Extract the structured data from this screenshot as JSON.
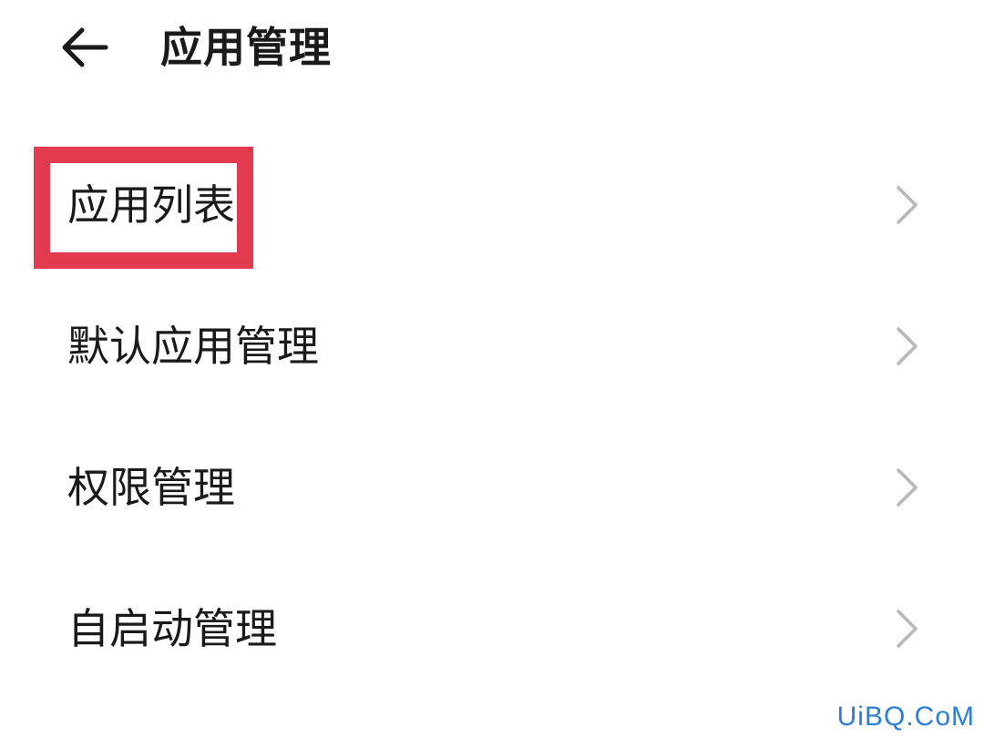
{
  "header": {
    "back_icon": "arrow-left-icon",
    "title": "应用管理"
  },
  "menu": {
    "items": [
      {
        "label": "应用列表",
        "icon": "chevron-right-icon",
        "highlighted": true
      },
      {
        "label": "默认应用管理",
        "icon": "chevron-right-icon",
        "highlighted": false
      },
      {
        "label": "权限管理",
        "icon": "chevron-right-icon",
        "highlighted": false
      },
      {
        "label": "自启动管理",
        "icon": "chevron-right-icon",
        "highlighted": false
      }
    ]
  },
  "highlight": {
    "color": "#e23a4f"
  },
  "watermark": {
    "text": "UiBQ.CoM",
    "color": "#2a7fd4"
  }
}
